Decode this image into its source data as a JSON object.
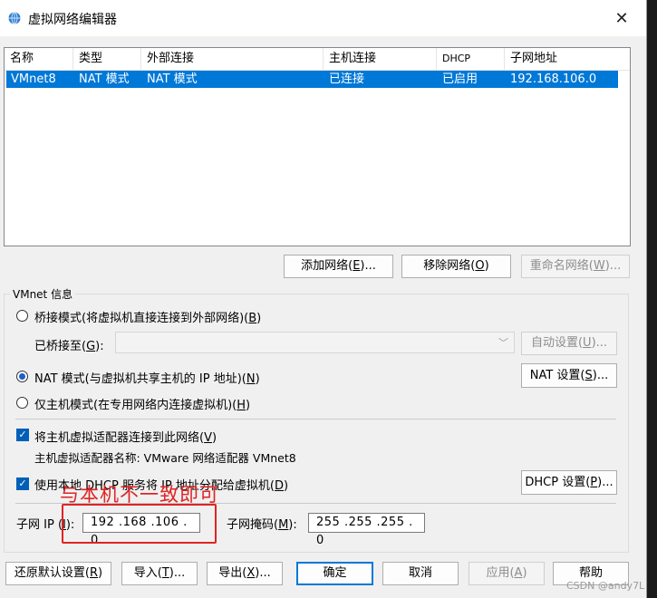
{
  "window": {
    "title": "虚拟网络编辑器",
    "close_glyph": "✕"
  },
  "list": {
    "columns": [
      "名称",
      "类型",
      "外部连接",
      "主机连接",
      "DHCP",
      "子网地址"
    ],
    "rows": [
      {
        "name": "VMnet8",
        "type": "NAT 模式",
        "external": "NAT 模式",
        "host": "已连接",
        "dhcp": "已启用",
        "subnet": "192.168.106.0"
      }
    ]
  },
  "list_buttons": {
    "add": {
      "text": "添加网络(",
      "key": "E",
      "suffix": ")..."
    },
    "remove": {
      "text": "移除网络(",
      "key": "O",
      "suffix": ")"
    },
    "rename": {
      "text": "重命名网络(",
      "key": "W",
      "suffix": ")..."
    }
  },
  "vmnet_info": {
    "label": "VMnet 信息",
    "bridge": {
      "text": "桥接模式(将虚拟机直接连接到外部网络)(",
      "key": "B",
      "suffix": ")"
    },
    "bridged_to": {
      "text": "已桥接至(",
      "key": "G",
      "suffix": "):"
    },
    "auto_settings": {
      "text": "自动设置(",
      "key": "U",
      "suffix": ")..."
    },
    "nat": {
      "text": "NAT 模式(与虚拟机共享主机的 IP 地址)(",
      "key": "N",
      "suffix": ")"
    },
    "nat_settings": {
      "text": "NAT 设置(",
      "key": "S",
      "suffix": ")..."
    },
    "host_only": {
      "text": "仅主机模式(在专用网络内连接虚拟机)(",
      "key": "H",
      "suffix": ")"
    },
    "connect_adapter": {
      "text": "将主机虚拟适配器连接到此网络(",
      "key": "V",
      "suffix": ")"
    },
    "adapter_name": "主机虚拟适配器名称: VMware 网络适配器 VMnet8",
    "use_dhcp": {
      "text": "使用本地 DHCP 服务将 IP 地址分配给虚拟机(",
      "key": "D",
      "suffix": ")"
    },
    "dhcp_settings": {
      "text": "DHCP 设置(",
      "key": "P",
      "suffix": ")..."
    },
    "subnet_ip_label": {
      "text": "子网 IP (",
      "key": "I",
      "suffix": "):"
    },
    "subnet_ip_value": "192 .168 .106 .  0",
    "subnet_mask_label": {
      "text": "子网掩码(",
      "key": "M",
      "suffix": "):"
    },
    "subnet_mask_value": "255 .255 .255 .  0",
    "radio_selected": "nat",
    "connect_adapter_checked": true,
    "use_dhcp_checked": true
  },
  "annotation": "与本机不一致即可",
  "bottom_buttons": {
    "restore": {
      "text": "还原默认设置(",
      "key": "R",
      "suffix": ")"
    },
    "import": {
      "text": "导入(",
      "key": "T",
      "suffix": ")..."
    },
    "export": {
      "text": "导出(",
      "key": "X",
      "suffix": ")..."
    },
    "ok": "确定",
    "cancel": "取消",
    "apply": {
      "text": "应用(",
      "key": "A",
      "suffix": ")"
    },
    "help": "帮助"
  },
  "watermark": "CSDN @andy7L",
  "colors": {
    "selection": "#0078d7",
    "annotation": "#e02424",
    "accent": "#005fb8"
  }
}
